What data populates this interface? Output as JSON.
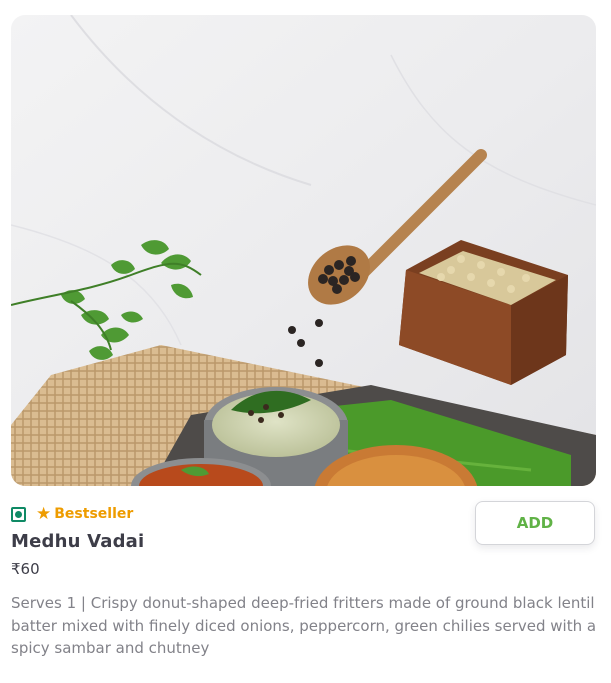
{
  "item": {
    "image_alt": "Medhu Vadai",
    "veg_icon": "veg-indicator-icon",
    "bestseller_icon": "star-icon",
    "bestseller_label": "Bestseller",
    "name": "Medhu Vadai",
    "price": "₹60",
    "description": "Serves 1 | Crispy donut-shaped deep-fried fritters made of ground black lentil batter mixed with finely diced onions, peppercorn, green chilies served with a spicy sambar and chutney",
    "add_label": "ADD"
  },
  "colors": {
    "veg": "#0f8a65",
    "bestseller": "#ee9c00",
    "add": "#60b246",
    "title": "#3d3d48",
    "description": "#828289"
  }
}
